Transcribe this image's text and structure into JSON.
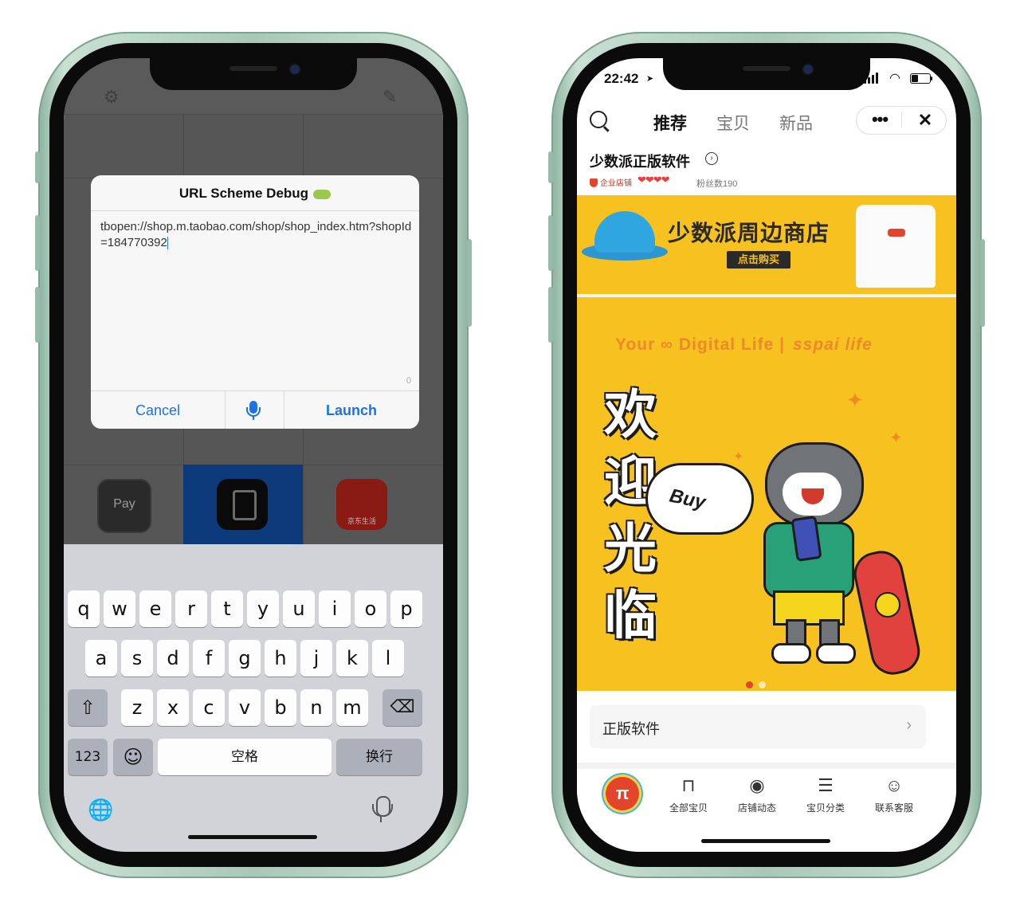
{
  "left_phone": {
    "dialog": {
      "title": "URL Scheme Debug",
      "url_text": "tbopen://shop.m.taobao.com/shop/shop_index.htm?shopId=184770392",
      "char_count": "0",
      "cancel_label": "Cancel",
      "launch_label": "Launch"
    },
    "apps": {
      "applepay_label": "Pay",
      "jd_label": "京东生活"
    },
    "keyboard": {
      "row1": [
        "q",
        "w",
        "e",
        "r",
        "t",
        "y",
        "u",
        "i",
        "o",
        "p"
      ],
      "row2": [
        "a",
        "s",
        "d",
        "f",
        "g",
        "h",
        "j",
        "k",
        "l"
      ],
      "row3": [
        "z",
        "x",
        "c",
        "v",
        "b",
        "n",
        "m"
      ],
      "numbers_label": "123",
      "space_label": "空格",
      "return_label": "换行",
      "shift_glyph": "⇧",
      "delete_glyph": "⌫",
      "emoji_glyph": "☺",
      "globe_glyph": "🌐"
    }
  },
  "right_phone": {
    "status": {
      "time": "22:42"
    },
    "nav": {
      "tabs": [
        "推荐",
        "宝贝",
        "新品"
      ],
      "active_tab": "推荐",
      "more_glyph": "•••",
      "close_glyph": "✕"
    },
    "shop": {
      "name": "少数派正版软件",
      "badge": "企业店铺",
      "hearts": "❤❤❤❤",
      "fans": "粉丝数190"
    },
    "banner1": {
      "title": "少数派周边商店",
      "button": "点击购买"
    },
    "banner2": {
      "tagline": "Your ∞ Digital Life |",
      "tagline_script": "sspai life",
      "welcome": [
        "欢",
        "迎",
        "光",
        "临"
      ],
      "bubble": "Buy"
    },
    "section": {
      "label": "正版软件",
      "chevron": "›"
    },
    "tabbar": [
      {
        "label": "全部宝贝",
        "icon": "bag-icon",
        "glyph": "⊓"
      },
      {
        "label": "店铺动态",
        "icon": "broadcast-icon",
        "glyph": "◉"
      },
      {
        "label": "宝贝分类",
        "icon": "list-icon",
        "glyph": "☰"
      },
      {
        "label": "联系客服",
        "icon": "service-icon",
        "glyph": "☺"
      }
    ],
    "logo_glyph": "π"
  },
  "colors": {
    "ios_blue": "#1a73e8",
    "banner_yellow": "#f7c11f",
    "brand_red": "#e2442c",
    "frame_green": "#a9c8b8"
  }
}
